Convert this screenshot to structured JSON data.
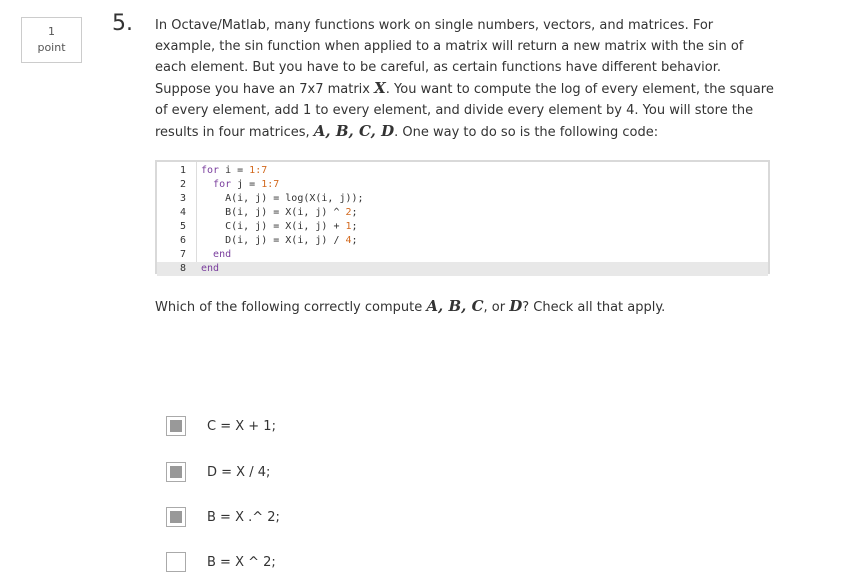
{
  "points": {
    "value": "1",
    "label": "point"
  },
  "question": {
    "number": "5.",
    "text_1": "In Octave/Matlab, many functions work on single numbers, vectors, and matrices. For example, the sin function when applied to a matrix will return a new matrix with the sin of each element. But you have to be careful, as certain functions have different behavior. Suppose you have an 7x7 matrix ",
    "math_X": "X",
    "text_2": ". You want to compute the log of every element, the square of every element, add 1 to every element, and divide every element by 4. You will store the results in four matrices, ",
    "math_ABCD": "A, B, C, D",
    "text_3": ". One way to do so is the following code:"
  },
  "code": {
    "line_numbers": [
      "1",
      "2",
      "3",
      "4",
      "5",
      "6",
      "7",
      "8"
    ],
    "lines": [
      "for i = 1:7",
      "  for j = 1:7",
      "    A(i, j) = log(X(i, j));",
      "    B(i, j) = X(i, j) ^ 2;",
      "    C(i, j) = X(i, j) + 1;",
      "    D(i, j) = X(i, j) / 4;",
      "  end",
      "end"
    ]
  },
  "prompt": {
    "text_1": "Which of the following correctly compute ",
    "math_ABC": "A, B, C",
    "text_2": ", or ",
    "math_D": "D",
    "text_3": "? Check all that apply."
  },
  "options": [
    {
      "label": "C = X + 1;",
      "checked": true
    },
    {
      "label": "D = X / 4;",
      "checked": true
    },
    {
      "label": "B = X .^ 2;",
      "checked": true
    },
    {
      "label": "B = X ^ 2;",
      "checked": false
    }
  ]
}
